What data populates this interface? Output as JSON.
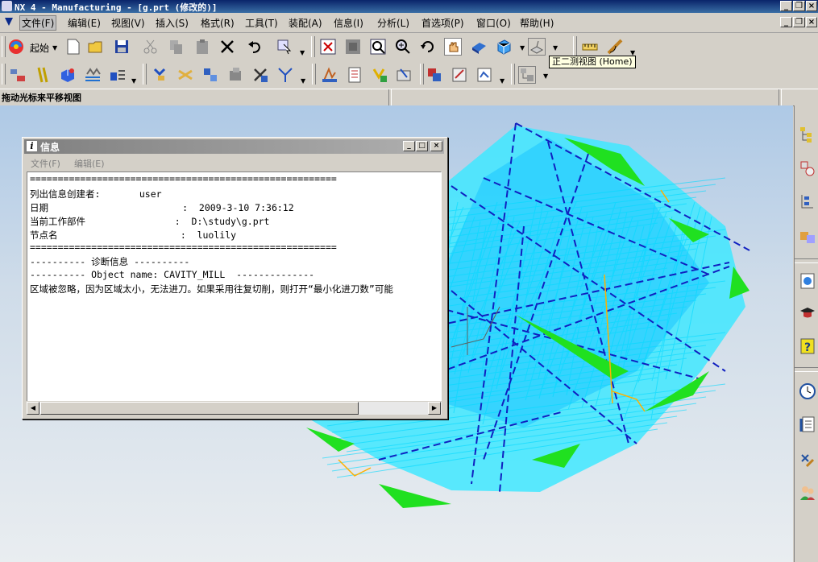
{
  "window": {
    "title": "NX 4 - Manufacturing - [g.prt (修改的)]"
  },
  "menubar": {
    "items": [
      "文件(F)",
      "编辑(E)",
      "视图(V)",
      "插入(S)",
      "格式(R)",
      "工具(T)",
      "装配(A)",
      "信息(I)",
      "分析(L)",
      "首选项(P)",
      "窗口(O)",
      "帮助(H)"
    ]
  },
  "toolbar": {
    "start_label": "起始",
    "tooltip": "正二测视图 (Home)"
  },
  "status": {
    "prompt": "拖动光标来平移视图"
  },
  "info_window": {
    "title": "信息",
    "menu": [
      "文件(F)",
      "编辑(E)"
    ],
    "lines": [
      "=======================================================",
      "列出信息创建者:       user",
      "日期                        :  2009-3-10 7:36:12",
      "当前工作部件                :  D:\\study\\g.prt",
      "节点名                      :  luolily",
      "=======================================================",
      "---------- 诊断信息 ----------",
      "---------- Object name: CAVITY_MILL  --------------",
      "区域被忽略，因为区域太小，无法进刀。如果采用往复切削，则打开“最小化进刀数”可能"
    ]
  },
  "icons": {
    "toolbar1": [
      "start-icon",
      "new-file-icon",
      "open-folder-icon",
      "save-icon",
      "cut-icon",
      "copy-icon",
      "paste-icon",
      "delete-icon",
      "undo-icon",
      "select-filter-icon",
      "fit-view-icon",
      "zoom-window-icon",
      "zoom-icon",
      "zoom-inout-icon",
      "rotate-icon",
      "pan-icon",
      "shaded-icon",
      "orient-view-icon",
      "view-triad-icon",
      "measure-icon",
      "ruler-icon"
    ],
    "toolbar2": [
      "program-order-icon",
      "machine-tool-icon",
      "geometry-view-icon",
      "method-view-icon",
      "create-program-icon",
      "create-tool-icon",
      "create-geometry-icon",
      "create-method-icon",
      "create-operation-icon",
      "generate-toolpath-icon",
      "replay-toolpath-icon",
      "verify-toolpath-icon",
      "list-toolpath-icon",
      "postprocess-icon",
      "shop-doc-icon",
      "output-cls-icon",
      "feeds-speeds-icon",
      "transform-icon",
      "display-object-icon"
    ],
    "resource_bar": [
      "operation-navigator-icon",
      "machine-navigator-icon",
      "part-navigator-icon",
      "assembly-navigator-icon",
      "web-browser-icon",
      "training-icon",
      "help-icon",
      "history-icon",
      "system-materials-icon",
      "process-studio-icon",
      "roles-icon"
    ]
  },
  "colors": {
    "titlebar": "#0a246a",
    "viewport_top": "#aec9e6",
    "toolpath_cyan": "#00e5ff",
    "toolpath_blue": "#1020c0",
    "toolpath_green": "#20e020"
  }
}
